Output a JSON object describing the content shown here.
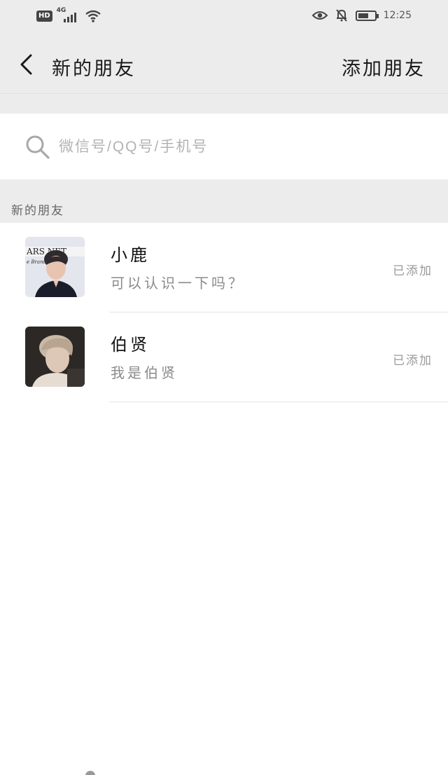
{
  "status_bar": {
    "hd_badge": "HD",
    "network": "4G",
    "time": "12:25",
    "icons": [
      "eye-icon",
      "bell-off-icon",
      "battery-icon",
      "wifi-icon",
      "signal-icon"
    ]
  },
  "header": {
    "back_icon": "chevron-left-icon",
    "title": "新的朋友",
    "action": "添加朋友"
  },
  "search": {
    "icon": "search-icon",
    "value": "",
    "placeholder": "微信号/QQ号/手机号"
  },
  "section": {
    "title": "新的朋友"
  },
  "friends": [
    {
      "name": "小鹿",
      "message": "可以认识一下吗？",
      "status": "已添加"
    },
    {
      "name": "伯贤",
      "message": "我是伯贤",
      "status": "已添加"
    }
  ],
  "colors": {
    "header_bg": "#ececec",
    "page_bg": "#ffffff",
    "text_primary": "#1a1a1a",
    "text_secondary": "#8a8a8a",
    "placeholder": "#b3b3b3"
  }
}
